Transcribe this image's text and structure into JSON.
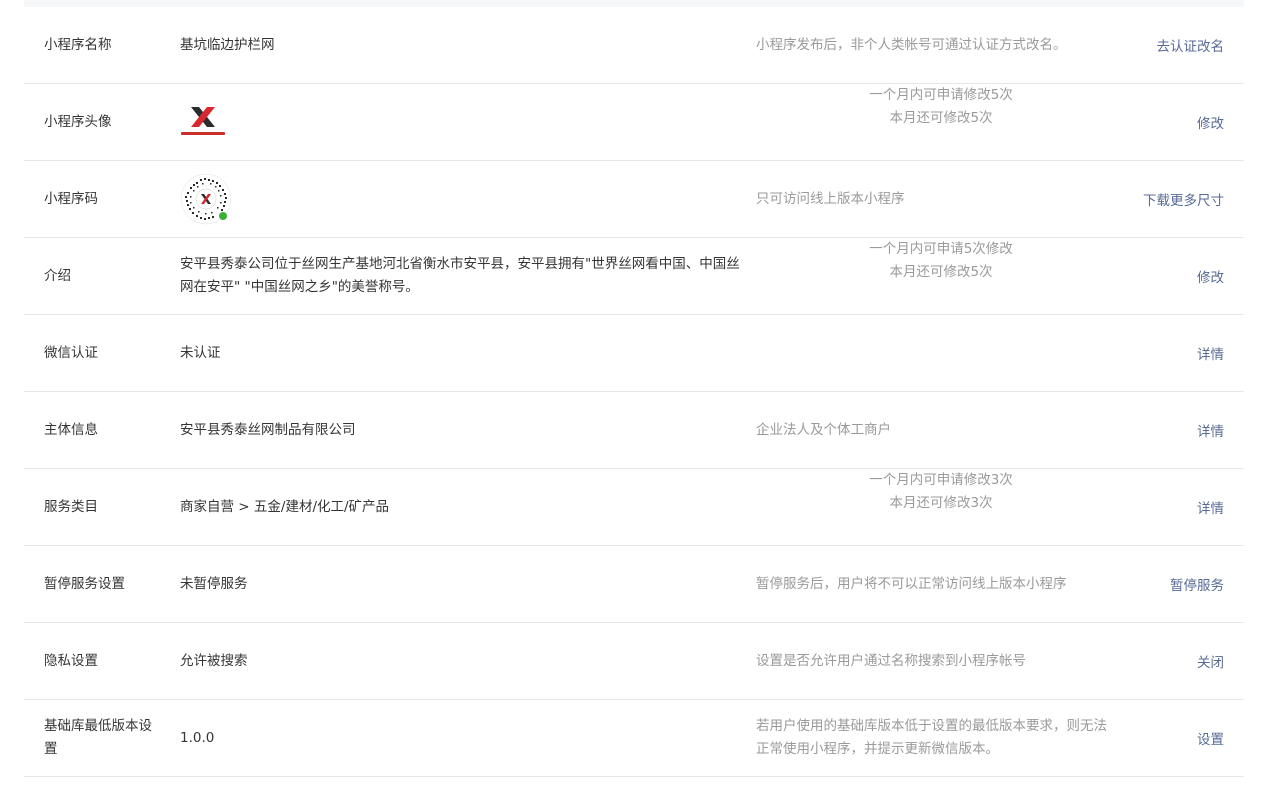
{
  "rows": [
    {
      "label": "小程序名称",
      "value": "基坑临边护栏网",
      "desc": [
        "小程序发布后，非个人类帐号可通过认证方式改名。"
      ],
      "action": "去认证改名"
    },
    {
      "label": "小程序头像",
      "value": "",
      "desc": [
        "一个月内可申请修改5次",
        "本月还可修改5次"
      ],
      "action": "修改"
    },
    {
      "label": "小程序码",
      "value": "",
      "desc": [
        "只可访问线上版本小程序"
      ],
      "action": "下载更多尺寸"
    },
    {
      "label": "介绍",
      "value": "安平县秀泰公司位于丝网生产基地河北省衡水市安平县，安平县拥有\"世界丝网看中国、中国丝网在安平\" \"中国丝网之乡\"的美誉称号。",
      "desc": [
        "一个月内可申请5次修改",
        "本月还可修改5次"
      ],
      "action": "修改"
    },
    {
      "label": "微信认证",
      "value": "未认证",
      "desc": [],
      "action": "详情"
    },
    {
      "label": "主体信息",
      "value": "安平县秀泰丝网制品有限公司",
      "desc": [
        "企业法人及个体工商户"
      ],
      "action": "详情"
    },
    {
      "label": "服务类目",
      "value": "商家自营 > 五金/建材/化工/矿产品",
      "desc": [
        "一个月内可申请修改3次",
        "本月还可修改3次"
      ],
      "action": "详情"
    },
    {
      "label": "暂停服务设置",
      "value": "未暂停服务",
      "desc": [
        "暂停服务后，用户将不可以正常访问线上版本小程序"
      ],
      "action": "暂停服务"
    },
    {
      "label": "隐私设置",
      "value": "允许被搜索",
      "desc": [
        "设置是否允许用户通过名称搜索到小程序帐号"
      ],
      "action": "关闭"
    },
    {
      "label": "基础库最低版本设置",
      "value": "1.0.0",
      "desc": [
        "若用户使用的基础库版本低于设置的最低版本要求，则无法正常使用小程序，并提示更新微信版本。"
      ],
      "action": "设置"
    }
  ]
}
